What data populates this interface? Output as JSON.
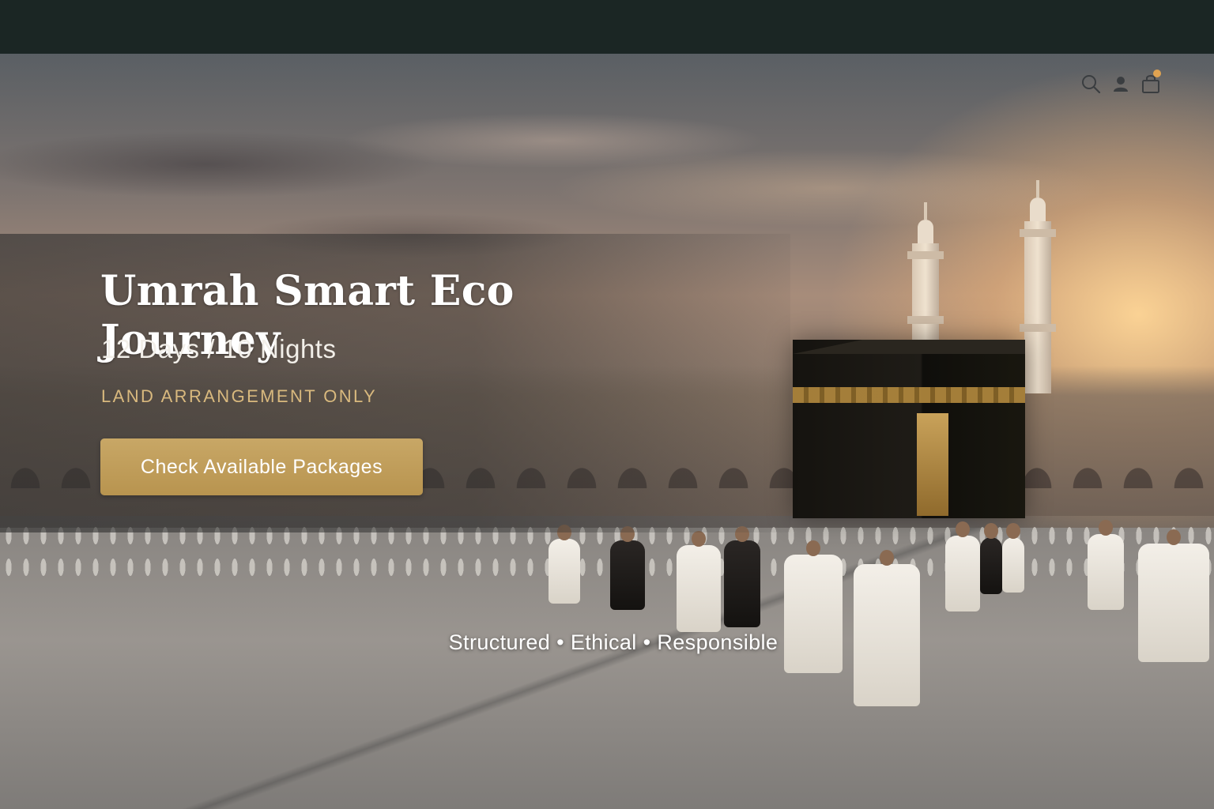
{
  "hero": {
    "title": "Umrah Smart Eco Journey",
    "duration": "12 Days / 10 Nights",
    "subtag": "LAND ARRANGEMENT ONLY",
    "cta_label": "Check Available Packages",
    "tagline": "Structured • Ethical • Responsible"
  },
  "header": {
    "icons": [
      "search-icon",
      "user-icon",
      "shopping-bag-icon"
    ],
    "cart_badge": true
  },
  "colors": {
    "top_bar": "#1b2624",
    "accent_gold": "#c8a766",
    "subtag_gold": "#d9b97e",
    "cart_dot": "#e0a351"
  }
}
